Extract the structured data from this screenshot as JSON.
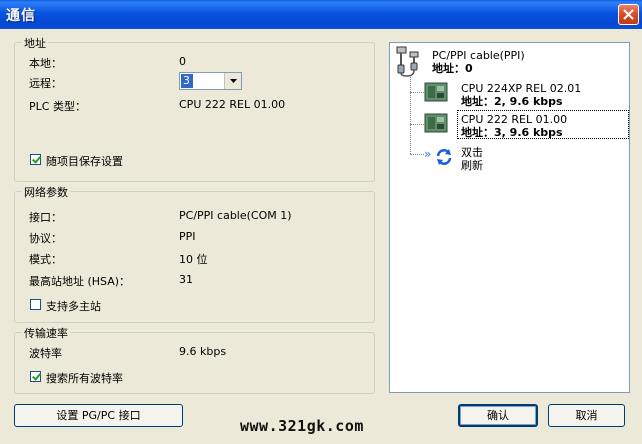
{
  "window": {
    "title": "通信"
  },
  "address_group": {
    "legend": "地址",
    "local_label": "本地：",
    "local_value": "0",
    "remote_label": "远程：",
    "remote_value": "3",
    "plc_type_label": "PLC 类型：",
    "plc_type_value": "CPU 222 REL 01.00",
    "save_with_project_label": "随项目保存设置",
    "save_with_project_checked": true
  },
  "network_group": {
    "legend": "网络参数",
    "interface_label": "接口：",
    "interface_value": "PC/PPI cable(COM 1)",
    "protocol_label": "协议：",
    "protocol_value": "PPI",
    "mode_label": "模式：",
    "mode_value": "10 位",
    "hsa_label": "最高站地址 (HSA)：",
    "hsa_value": "31",
    "multi_master_label": "支持多主站",
    "multi_master_checked": false
  },
  "baud_group": {
    "legend": "传输速率",
    "baud_label": "波特率",
    "baud_value": "9.6 kbps",
    "search_all_label": "搜索所有波特率",
    "search_all_checked": true
  },
  "tree": {
    "cable_name": "PC/PPI cable(PPI)",
    "cable_address": "地址：0",
    "devices": [
      {
        "name": "CPU 224XP REL 02.01",
        "address": "地址：2, 9.6 kbps"
      },
      {
        "name": "CPU 222 REL 01.00",
        "address": "地址：3, 9.6 kbps"
      }
    ],
    "refresh_line1": "双击",
    "refresh_line2": "刷新"
  },
  "buttons": {
    "set_pgpc": "设置 PG/PC 接口",
    "ok": "确认",
    "cancel": "取消"
  },
  "watermark": "www.321gk.com"
}
